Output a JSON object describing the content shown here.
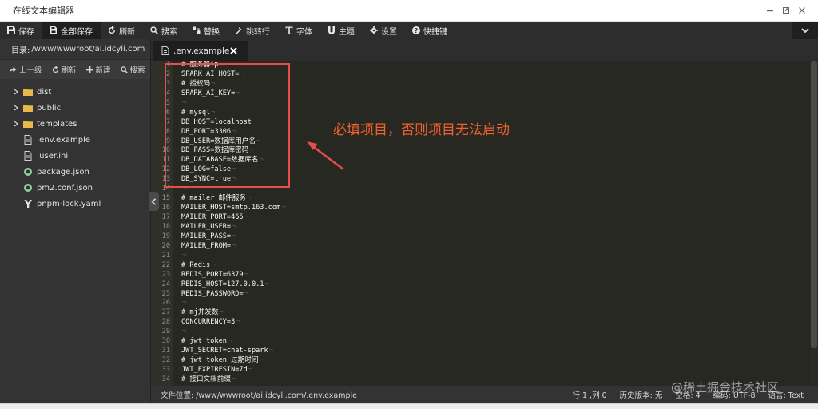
{
  "window": {
    "title": "在线文本编辑器"
  },
  "toolbar": {
    "buttons": [
      {
        "label": "保存",
        "icon": "save-icon"
      },
      {
        "label": "全部保存",
        "icon": "save-all-icon"
      },
      {
        "label": "刷新",
        "icon": "refresh-icon"
      },
      {
        "label": "搜索",
        "icon": "search-icon"
      },
      {
        "label": "替换",
        "icon": "replace-icon"
      },
      {
        "label": "跳转行",
        "icon": "goto-line-icon"
      },
      {
        "label": "字体",
        "icon": "font-icon"
      },
      {
        "label": "主题",
        "icon": "theme-icon"
      },
      {
        "label": "设置",
        "icon": "gear-icon"
      },
      {
        "label": "快捷键",
        "icon": "help-icon"
      }
    ]
  },
  "sidebar": {
    "dir_label": "目录:",
    "dir_path": "/www/wwwroot/ai.idcyli.com",
    "actions": {
      "up": "上一级",
      "refresh": "刷新",
      "new": "新建",
      "search": "搜索"
    },
    "tree": [
      {
        "name": "dist",
        "type": "folder"
      },
      {
        "name": "public",
        "type": "folder"
      },
      {
        "name": "templates",
        "type": "folder"
      },
      {
        "name": ".env.example",
        "type": "file"
      },
      {
        "name": ".user.ini",
        "type": "file"
      },
      {
        "name": "package.json",
        "type": "json"
      },
      {
        "name": "pm2.conf.json",
        "type": "json"
      },
      {
        "name": "pnpm-lock.yaml",
        "type": "yaml"
      }
    ]
  },
  "tab": {
    "label": ".env.example"
  },
  "editor": {
    "lines": [
      "# 服务器ip",
      "SPARK_AI_HOST=",
      "# 授权码",
      "SPARK_AI_KEY=",
      "",
      "# mysql",
      "DB_HOST=localhost",
      "DB_PORT=3306",
      "DB_USER=数据库用户名",
      "DB_PASS=数据库密码",
      "DB_DATABASE=数据库名",
      "DB_LOG=false",
      "DB_SYNC=true",
      "",
      "#  mailer 邮件服务",
      "MAILER_HOST=smtp.163.com",
      "MAILER_PORT=465",
      "MAILER_USER=",
      "MAILER_PASS=",
      "MAILER_FROM=",
      "",
      "# Redis",
      "REDIS_PORT=6379",
      "REDIS_HOST=127.0.0.1",
      "REDIS_PASSWORD=",
      "",
      "# mj并发数",
      "CONCURRENCY=3",
      "",
      "# jwt token",
      "JWT_SECRET=chat-spark",
      "# jwt token 过期时间",
      "JWT_EXPIRESIN=7d",
      "# 接口文档前缀"
    ]
  },
  "annotation": {
    "text": "必填项目，否则项目无法启动"
  },
  "status": {
    "file_label": "文件位置:",
    "file_path": "/www/wwwroot/ai.idcyli.com/.env.example",
    "cursor": "行 1 ,列 0",
    "history": "历史版本: 无",
    "indent": "空格: 4",
    "encoding": "编码: UTF-8",
    "language": "语言: Text"
  },
  "watermark": "@稀土掘金技术社区",
  "colors": {
    "toolbar_bg": "#2d2d2d",
    "sidebar_bg": "#333333",
    "editor_bg": "#272822",
    "annotation": "#f0612f",
    "highlight_box": "#e84d4d",
    "folder": "#e8b84a"
  }
}
